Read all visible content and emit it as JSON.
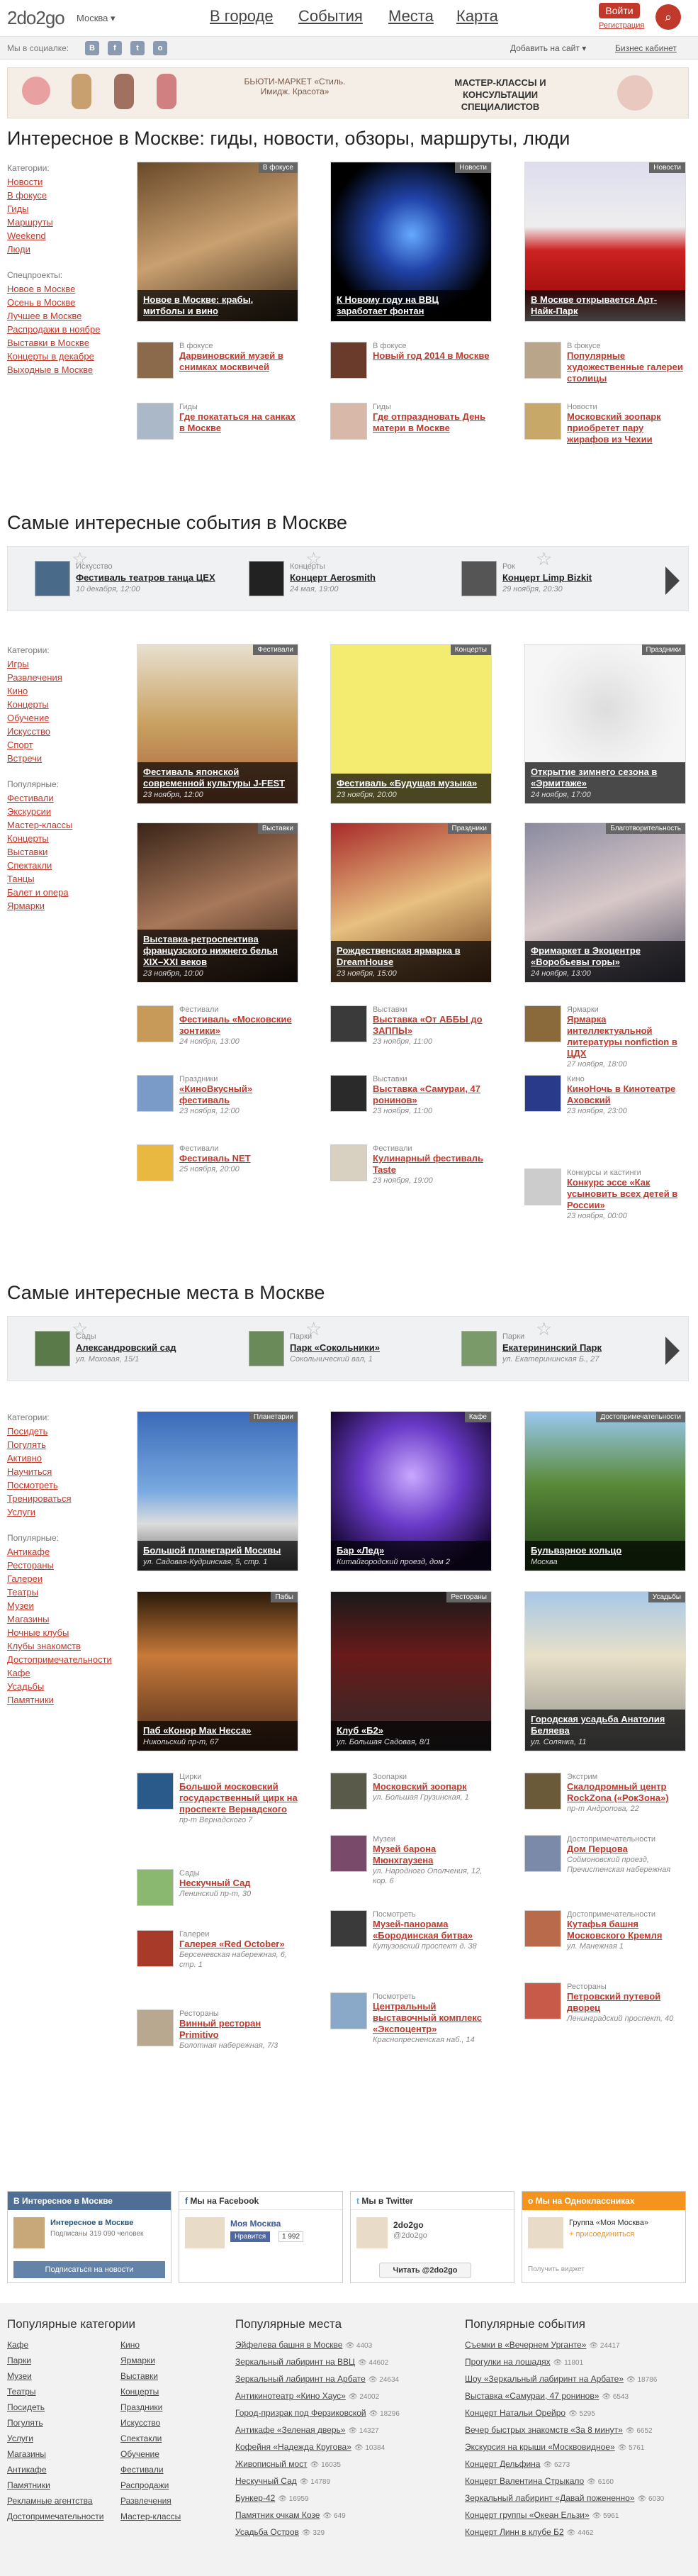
{
  "header": {
    "logo": "2do2go",
    "city": "Москва ▾",
    "nav": [
      "В городе",
      "События",
      "Места",
      "Карта"
    ],
    "login": "Войти",
    "register": "Регистрация"
  },
  "social": {
    "label": "Мы в социалке:",
    "icons": [
      "vk-icon",
      "fb-icon",
      "twitter-icon",
      "ok-icon"
    ],
    "add_site": "Добавить на сайт ▾",
    "business": "Бизнес кабинет"
  },
  "banner": {
    "left": "БЬЮТИ-МАРКЕТ «Стиль. Имидж. Красота»",
    "right": "МАСТЕР-КЛАССЫ И КОНСУЛЬТАЦИИ СПЕЦИАЛИСТОВ"
  },
  "sec1": {
    "title": "Интересное в Москве: гиды, новости, обзоры, маршруты, люди",
    "side": {
      "cats_label": "Категории:",
      "cats": [
        "Новости",
        "В фокусе",
        "Гиды",
        "Маршруты",
        "Weekend",
        "Люди"
      ],
      "spec_label": "Спецпроекты:",
      "spec": [
        "Новое в Москве",
        "Осень в Москве",
        "Лучшее в Москве",
        "Распродажи в ноябре",
        "Выставки в Москве",
        "Концерты в декабре",
        "Выходные в Москве"
      ]
    },
    "cards": [
      {
        "tag": "В фокусе",
        "title": "Новое в Москве: крабы, митболы и вино"
      },
      {
        "tag": "Новости",
        "title": "К Новому году на ВВЦ заработает фонтан"
      },
      {
        "tag": "Новости",
        "title": "В Москве открывается Арт-Найк-Парк"
      }
    ],
    "small": [
      {
        "cat": "В фокусе",
        "title": "Дарвиновский музей в снимках москвичей"
      },
      {
        "cat": "В фокусе",
        "title": "Новый год 2014 в Москве"
      },
      {
        "cat": "В фокусе",
        "title": "Популярные художественные галереи столицы"
      },
      {
        "cat": "Гиды",
        "title": "Где покататься на санках в Москве"
      },
      {
        "cat": "Гиды",
        "title": "Где отпраздновать День матери в Москве"
      },
      {
        "cat": "Новости",
        "title": "Московский зоопарк приобретет пару жирафов из Чехии"
      }
    ]
  },
  "sec2": {
    "title": "Самые интересные события в Москве",
    "carousel": [
      {
        "cat": "Искусство",
        "title": "Фестиваль театров танца ЦЕХ",
        "date": "10 декабря, 12:00"
      },
      {
        "cat": "Концерты",
        "title": "Концерт Aerosmith",
        "date": "24 мая, 19:00"
      },
      {
        "cat": "Рок",
        "title": "Концерт Limp Bizkit",
        "date": "29 ноября, 20:30"
      }
    ],
    "side": {
      "cats_label": "Категории:",
      "cats": [
        "Игры",
        "Развлечения",
        "Кино",
        "Концерты",
        "Обучение",
        "Искусство",
        "Спорт",
        "Встречи"
      ],
      "pop_label": "Популярные:",
      "pop": [
        "Фестивали",
        "Экскурсии",
        "Мастер-классы",
        "Концерты",
        "Выставки",
        "Спектакли",
        "Танцы",
        "Балет и опера",
        "Ярмарки"
      ]
    },
    "cards": [
      {
        "tag": "Фестивали",
        "title": "Фестиваль японской современной культуры J-FEST",
        "date": "23 ноября, 12:00"
      },
      {
        "tag": "Концерты",
        "title": "Фестиваль «Будущая музыка»",
        "date": "23 ноября, 20:00"
      },
      {
        "tag": "Праздники",
        "title": "Открытие зимнего сезона в «Эрмитаже»",
        "date": "24 ноября, 17:00"
      },
      {
        "tag": "Выставки",
        "title": "Выставка-ретроспектива французского нижнего белья XIX–XXI веков",
        "date": "23 ноября, 10:00"
      },
      {
        "tag": "Праздники",
        "title": "Рождественская ярмарка в DreamHouse",
        "date": "23 ноября, 15:00"
      },
      {
        "tag": "Благотворительность",
        "title": "Фримаркет в Экоцентре «Воробьевы горы»",
        "date": "24 ноября, 13:00"
      }
    ],
    "small": [
      {
        "cat": "Фестивали",
        "title": "Фестиваль «Московские зонтики»",
        "date": "24 ноября, 13:00"
      },
      {
        "cat": "Выставки",
        "title": "Выставка «От АББЫ до ЗАППЫ»",
        "date": "23 ноября, 11:00"
      },
      {
        "cat": "Ярмарки",
        "title": "Ярмарка интеллектуальной литературы nonfiction в ЦДХ",
        "date": "27 ноября, 18:00"
      },
      {
        "cat": "Праздники",
        "title": "«КиноВкусный» фестиваль",
        "date": "23 ноября, 12:00"
      },
      {
        "cat": "Выставки",
        "title": "Выставка «Самураи, 47 ронинов»",
        "date": "23 ноября, 11:00"
      },
      {
        "cat": "Кино",
        "title": "КиноНочь в Кинотеатре Аховский",
        "date": "23 ноября, 23:00"
      },
      {
        "cat": "Фестивали",
        "title": "Фестиваль NET",
        "date": "25 ноября, 20:00"
      },
      {
        "cat": "Фестивали",
        "title": "Кулинарный фестиваль Taste",
        "date": "23 ноября, 19:00"
      },
      {
        "cat": "Конкурсы и кастинги",
        "title": "Конкурс эссе «Как усыновить всех детей в России»",
        "date": "23 ноября, 00:00"
      }
    ]
  },
  "sec3": {
    "title": "Самые интересные места в Москве",
    "carousel": [
      {
        "cat": "Сады",
        "title": "Александровский сад",
        "date": "ул. Моховая, 15/1"
      },
      {
        "cat": "Парки",
        "title": "Парк «Сокольники»",
        "date": "Сокольнический вал, 1"
      },
      {
        "cat": "Парки",
        "title": "Екатерининский Парк",
        "date": "ул. Екатерининская Б., 27"
      }
    ],
    "side": {
      "cats_label": "Категории:",
      "cats": [
        "Посидеть",
        "Погулять",
        "Активно",
        "Научиться",
        "Посмотреть",
        "Тренироваться",
        "Услуги"
      ],
      "pop_label": "Популярные:",
      "pop": [
        "Антикафе",
        "Рестораны",
        "Галереи",
        "Театры",
        "Музеи",
        "Магазины",
        "Ночные клубы",
        "Клубы знакомств",
        "Достопримечательности",
        "Кафе",
        "Усадьбы",
        "Памятники"
      ]
    },
    "cards": [
      {
        "tag": "Планетарии",
        "title": "Большой планетарий Москвы",
        "date": "ул. Садовая-Кудринская, 5, стр. 1"
      },
      {
        "tag": "Кафе",
        "title": "Бар «Лед»",
        "date": "Китайгородский проезд, дом 2"
      },
      {
        "tag": "Достопримечательности",
        "title": "Бульварное кольцо",
        "date": "Москва"
      },
      {
        "tag": "Пабы",
        "title": "Паб «Конор Мак Несса»",
        "date": "Никольский пр-т, 67"
      },
      {
        "tag": "Рестораны",
        "title": "Клуб «Б2»",
        "date": "ул. Большая Садовая, 8/1"
      },
      {
        "tag": "Усадьбы",
        "title": "Городская усадьба Анатолия Беляева",
        "date": "ул. Солянка, 11"
      }
    ],
    "small": [
      {
        "cat": "Цирки",
        "title": "Большой московский государственный цирк на проспекте Вернадского",
        "date": "пр-т Вернадского 7"
      },
      {
        "cat": "Зоопарки",
        "title": "Московский зоопарк",
        "date": "ул. Большая Грузинская, 1"
      },
      {
        "cat": "Экстрим",
        "title": "Скалодромный центр RockZona («РокЗона»)",
        "date": "пр-т Андропова, 22"
      },
      {
        "cat": "Сады",
        "title": "Нескучный Сад",
        "date": "Ленинский пр-т, 30"
      },
      {
        "cat": "Музеи",
        "title": "Музей барона Мюнхгаузена",
        "date": "ул. Народного Ополчения, 12, кор. 6"
      },
      {
        "cat": "Достопримечательности",
        "title": "Дом Перцова",
        "date": "Соймоновский проезд, Пречистенская набережная"
      },
      {
        "cat": "Галереи",
        "title": "Галерея «Red October»",
        "date": "Берсеневская набережная, 6, стр. 1"
      },
      {
        "cat": "Посмотреть",
        "title": "Музей-панорама «Бородинская битва»",
        "date": "Кутузовский проспект д. 38"
      },
      {
        "cat": "Достопримечательности",
        "title": "Кутафья башня Московского Кремля",
        "date": "ул. Манежная 1"
      },
      {
        "cat": "Рестораны",
        "title": "Винный ресторан Primitivo",
        "date": "Болотная набережная, 7/3"
      },
      {
        "cat": "Посмотреть",
        "title": "Центральный выставочный комплекс «Экспоцентр»",
        "date": "Краснопресненская наб., 14"
      },
      {
        "cat": "Рестораны",
        "title": "Петровский путевой дворец",
        "date": "Ленинградский проспект, 40"
      }
    ]
  },
  "widgets": {
    "vk": {
      "head": "Интересное в Москве",
      "name": "Интересное в Москве",
      "subs": "Подписаны 319 090 человек",
      "btn": "Подписаться на новости"
    },
    "fb": {
      "head": "Мы на Facebook",
      "name": "Моя Москва",
      "like": "Нравится",
      "count": "1 992"
    },
    "tw": {
      "head": "Мы в Twitter",
      "name": "2do2go",
      "handle": "@2do2go",
      "btn": "Читать @2do2go"
    },
    "ok": {
      "head": "Мы на Одноклассниках",
      "name": "Группа «Моя Москва»",
      "join": "+ присоединиться",
      "login": "Получить виджет"
    }
  },
  "colors": {
    "accent": "#c0392b",
    "vk": "#4e6e96",
    "fb": "#3b5998",
    "tw": "#5ea9dd",
    "ok": "#f4931e"
  },
  "footer": {
    "h1": "Популярные категории",
    "h2": "Популярные места",
    "h3": "Популярные события",
    "cat_a": [
      "Кафе",
      "Парки",
      "Музеи",
      "Театры",
      "Посидеть",
      "Погулять",
      "Услуги",
      "Магазины",
      "Антикафе",
      "Памятники",
      "Рекламные агентства",
      "Достопримечательности"
    ],
    "cat_b": [
      "Кино",
      "Ярмарки",
      "Выставки",
      "Концерты",
      "Праздники",
      "Искусство",
      "Спектакли",
      "Обучение",
      "Фестивали",
      "Распродажи",
      "Развлечения",
      "Мастер-классы"
    ],
    "places": [
      {
        "t": "Эйфелева башня в Москве",
        "n": "4403"
      },
      {
        "t": "Зеркальный лабиринт на ВВЦ",
        "n": "44602"
      },
      {
        "t": "Зеркальный лабиринт на Арбате",
        "n": "24634"
      },
      {
        "t": "Антикинотеатр «Кино Хаус»",
        "n": "24002"
      },
      {
        "t": "Город-призрак под Ферзиковской",
        "n": "18296"
      },
      {
        "t": "Антикафе «Зеленая дверь»",
        "n": "14327"
      },
      {
        "t": "Кофейня «Надежда Кругова»",
        "n": "10384"
      },
      {
        "t": "Живописный мост",
        "n": "16035"
      },
      {
        "t": "Нескучный Сад",
        "n": "14789"
      },
      {
        "t": "Бункер-42",
        "n": "16959"
      },
      {
        "t": "Памятник очкам Козе",
        "n": "649"
      },
      {
        "t": "Усадьба Остров",
        "n": "329"
      }
    ],
    "events": [
      {
        "t": "Съемки в «Вечернем Урганте»",
        "n": "24417"
      },
      {
        "t": "Прогулки на лошадях",
        "n": "11801"
      },
      {
        "t": "Шоу «Зеркальный лабиринт на Арбате»",
        "n": "18786"
      },
      {
        "t": "Выставка «Самураи, 47 ронинов»",
        "n": "6543"
      },
      {
        "t": "Концерт Натальи Орейро",
        "n": "5295"
      },
      {
        "t": "Вечер быстрых знакомств «За 8 минут»",
        "n": "6652"
      },
      {
        "t": "Экскурсия на крыши «Москвовидное»",
        "n": "5761"
      },
      {
        "t": "Концерт Дельфина",
        "n": "6273"
      },
      {
        "t": "Концерт Валентина Стрыкало",
        "n": "6160"
      },
      {
        "t": "Зеркальный лабиринт «Давай пожененно»",
        "n": "6030"
      },
      {
        "t": "Концерт группы «Океан Ельзи»",
        "n": "5961"
      },
      {
        "t": "Концерт Линн в клубе Б2",
        "n": "4462"
      }
    ]
  }
}
